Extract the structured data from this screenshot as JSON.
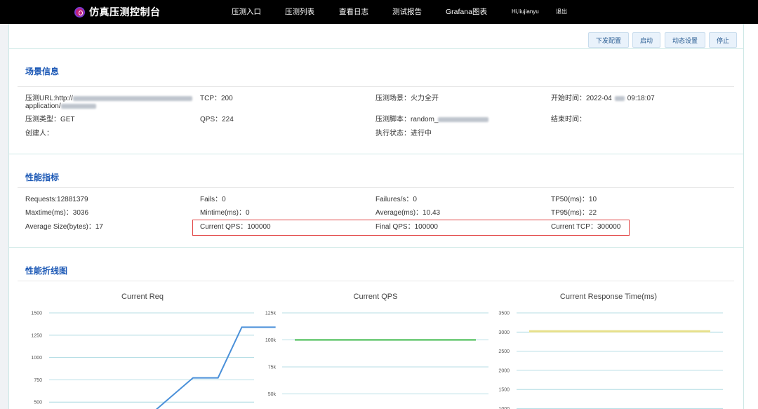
{
  "navbar": {
    "title": "仿真压测控制台",
    "items": [
      "压测入口",
      "压测列表",
      "查看日志",
      "测试报告",
      "Grafana图表"
    ],
    "user": "Hi,liujianyu",
    "logout": "退出"
  },
  "toolbar": {
    "buttons": [
      "下发配置",
      "启动",
      "动态设置",
      "停止"
    ]
  },
  "scene": {
    "title": "场景信息",
    "url_label": "压测URL:",
    "url_value_line1": "http://",
    "url_value_line2": "application/",
    "tcp_label": "TCP：",
    "tcp_value": "200",
    "scene_label": "压测场景：",
    "scene_value": "火力全开",
    "start_label": "开始时间：",
    "start_value_prefix": "2022-04",
    "start_value_suffix": "09:18:07",
    "type_label": "压测类型：",
    "type_value": "GET",
    "qps_label": "QPS：",
    "qps_value": "224",
    "script_label": "压测脚本：",
    "script_value": "random_",
    "end_label": "结束时间：",
    "end_value": "",
    "creator_label": "创建人：",
    "creator_value": "",
    "status_label": "执行状态：",
    "status_value": "进行中"
  },
  "metrics": {
    "title": "性能指标",
    "requests": "Requests:12881379",
    "fails": "Fails：0",
    "failures_per_s": "Failures/s：0",
    "tp50": "TP50(ms)：10",
    "maxtime": "Maxtime(ms)：3036",
    "mintime": "Mintime(ms)：0",
    "average": "Average(ms)：10.43",
    "tp95": "TP95(ms)：22",
    "avg_size": "Average Size(bytes)：17",
    "current_qps": "Current QPS：100000",
    "final_qps": "Final QPS：100000",
    "current_tcp": "Current TCP：300000"
  },
  "charts_section": {
    "title": "性能折线图"
  },
  "chart_data": [
    {
      "type": "line",
      "title": "Current Req",
      "xlabel": "",
      "ylabel": "",
      "yticks": [
        "1500",
        "1250",
        "1000",
        "750",
        "500"
      ],
      "ylim": [
        420,
        1500
      ],
      "color": "#4a90d9",
      "series": [
        {
          "x": [
            0,
            150,
            165,
            230,
            270,
            308,
            362
          ],
          "values": [
            380,
            380,
            380,
            772,
            772,
            1340,
            1340
          ]
        }
      ]
    },
    {
      "type": "line",
      "title": "Current QPS",
      "xlabel": "",
      "ylabel": "",
      "yticks": [
        "125k",
        "100k",
        "75k",
        "50k"
      ],
      "ylim": [
        45000,
        125000
      ],
      "color": "#3cb94a",
      "series": [
        {
          "x": [
            0,
            1
          ],
          "values": [
            100000,
            100000
          ]
        }
      ]
    },
    {
      "type": "line",
      "title": "Current Response Time(ms)",
      "xlabel": "",
      "ylabel": "",
      "yticks": [
        "3500",
        "3000",
        "2500",
        "2000",
        "1500",
        "1000"
      ],
      "ylim": [
        1000,
        3500
      ],
      "color": "#e7e08a",
      "series": [
        {
          "x": [
            0,
            1
          ],
          "values": [
            3020,
            3020
          ]
        }
      ]
    }
  ]
}
